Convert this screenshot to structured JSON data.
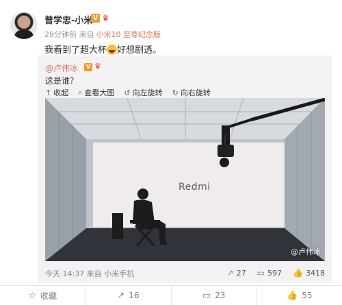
{
  "post": {
    "author": "曾学忠-小米",
    "badge_v": "V",
    "meta_time": "29分钟前 来自",
    "meta_device": "小米10 至尊纪念版",
    "text_before": "我看到了超大杯",
    "text_after": "好想剧透。"
  },
  "repost": {
    "author": "@卢伟冰",
    "badge_v": "V",
    "text": "这是谁？",
    "tools": [
      {
        "label": "收起",
        "icon": "collapse-icon"
      },
      {
        "label": "查看大图",
        "icon": "zoom-icon"
      },
      {
        "label": "向左旋转",
        "icon": "rotate-left-icon"
      },
      {
        "label": "向右旋转",
        "icon": "rotate-right-icon"
      }
    ],
    "image": {
      "logo_text": "Redmi",
      "watermark": "@卢伟冰"
    },
    "footer_time": "今天 14:37 来自 小米手机",
    "stats": {
      "repost": "27",
      "comment": "597",
      "like": "3418"
    }
  },
  "actions": {
    "favorite": "收藏",
    "repost": "16",
    "comment": "23",
    "like": "55"
  },
  "colors": {
    "accent": "#eb7350",
    "badge": "#f59b21"
  }
}
